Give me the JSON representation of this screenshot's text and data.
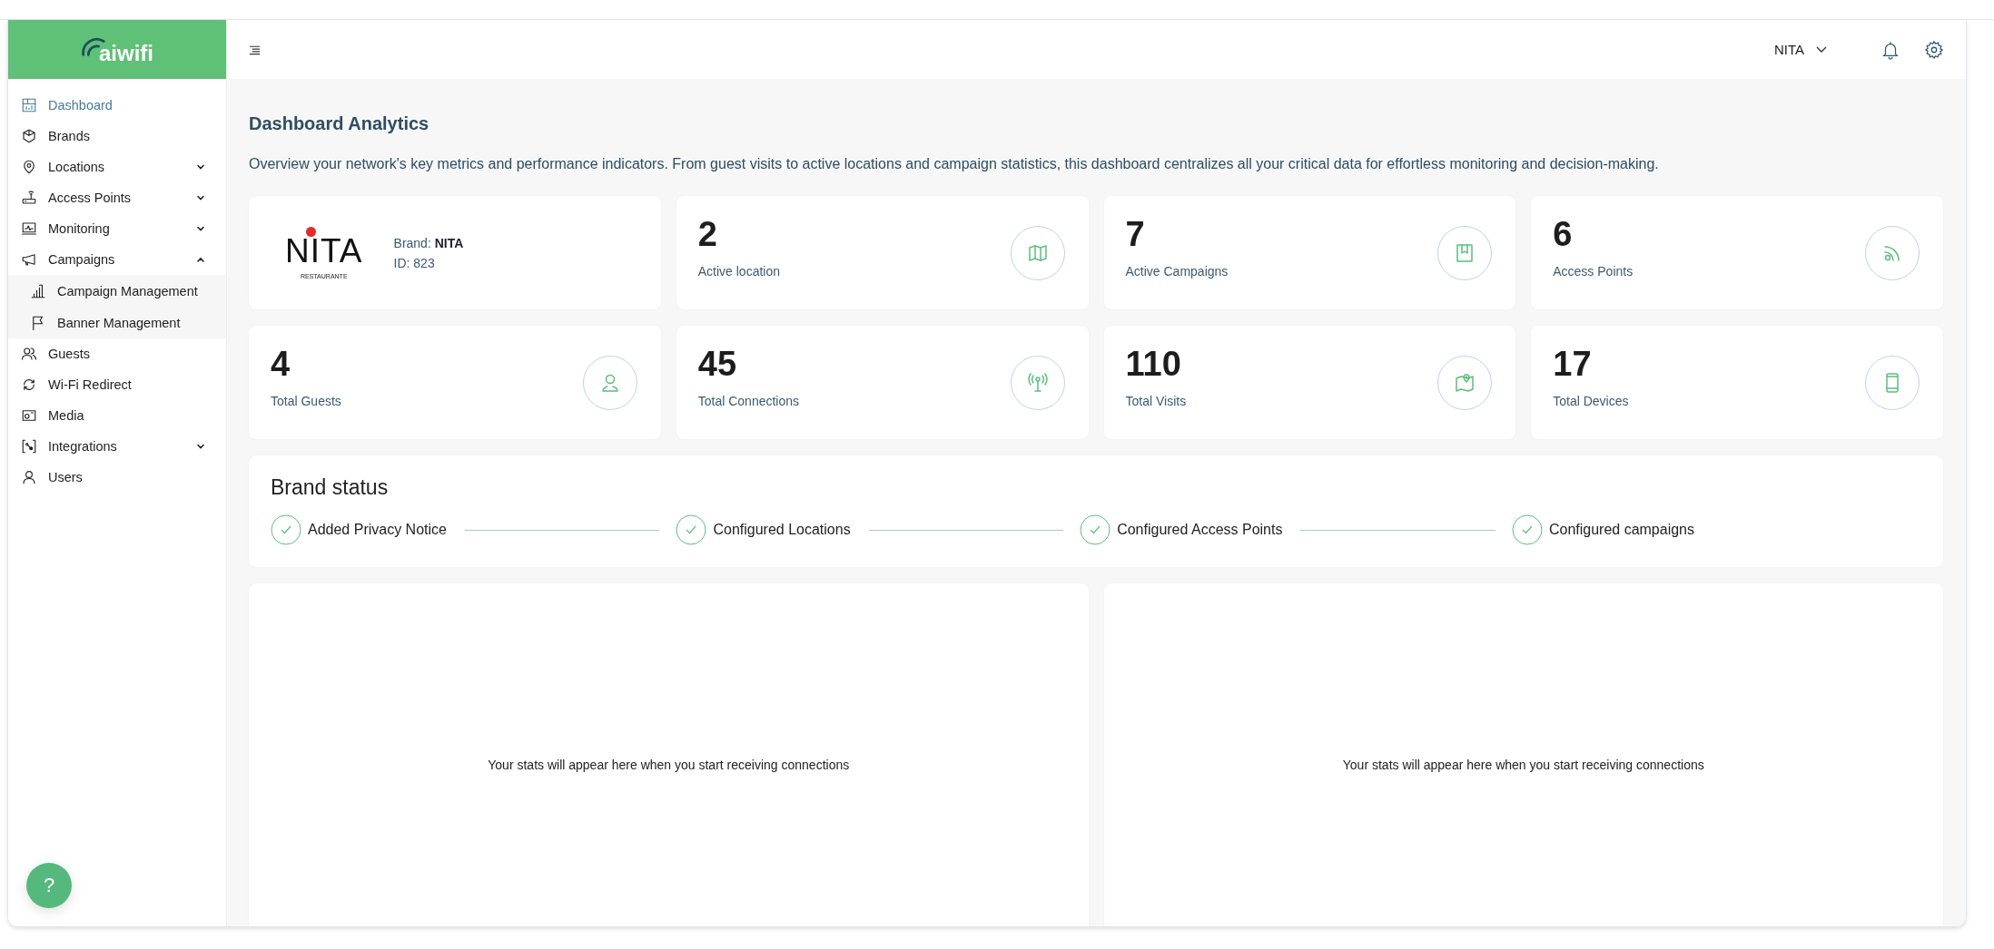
{
  "logo": {
    "text": "aiwifi"
  },
  "sidebar": {
    "items": [
      {
        "label": "Dashboard",
        "selected": true
      },
      {
        "label": "Brands",
        "selected": false
      },
      {
        "label": "Locations",
        "selected": false,
        "expanded": false
      },
      {
        "label": "Access Points",
        "selected": false,
        "expanded": false
      },
      {
        "label": "Monitoring",
        "selected": false,
        "expanded": false
      },
      {
        "label": "Campaigns",
        "selected": false,
        "expanded": true,
        "children": [
          {
            "label": "Campaign Management",
            "selected": false
          },
          {
            "label": "Banner Management",
            "selected": false
          }
        ]
      },
      {
        "label": "Guests",
        "selected": false
      },
      {
        "label": "Wi-Fi Redirect",
        "selected": false
      },
      {
        "label": "Media",
        "selected": false
      },
      {
        "label": "Integrations",
        "selected": false,
        "expanded": false
      },
      {
        "label": "Users",
        "selected": false
      }
    ]
  },
  "header": {
    "user": "NITA"
  },
  "page": {
    "title": "Dashboard Analytics",
    "description": "Overview your network's key metrics and performance indicators. From guest visits to active locations and campaign statistics, this dashboard centralizes all your critical data for effortless monitoring and decision-making."
  },
  "brand_card": {
    "logo_text": "NITA",
    "logo_subtext": "RESTAURANTE",
    "brand": "Brand: **NITA**",
    "id": "ID: 823"
  },
  "stats": [
    {
      "value": "2",
      "label": "Active location"
    },
    {
      "value": "7",
      "label": "Active Campaigns"
    },
    {
      "value": "6",
      "label": "Access Points"
    },
    {
      "value": "4",
      "label": "Total Guests"
    },
    {
      "value": "45",
      "label": "Total Connections"
    },
    {
      "value": "110",
      "label": "Total Visits"
    },
    {
      "value": "17",
      "label": "Total Devices"
    }
  ],
  "brand_status": {
    "title": "Brand status",
    "steps": [
      {
        "label": "Added Privacy Notice",
        "done": true
      },
      {
        "label": "Configured Locations",
        "done": true
      },
      {
        "label": "Configured Access Points",
        "done": true
      },
      {
        "label": "Configured campaigns",
        "done": true
      }
    ]
  },
  "panels": [
    {
      "message": "Your stats will appear here when you start receiving connections"
    },
    {
      "message": "Your stats will appear here when you start receiving connections"
    }
  ],
  "help_button": {
    "label": "?"
  }
}
